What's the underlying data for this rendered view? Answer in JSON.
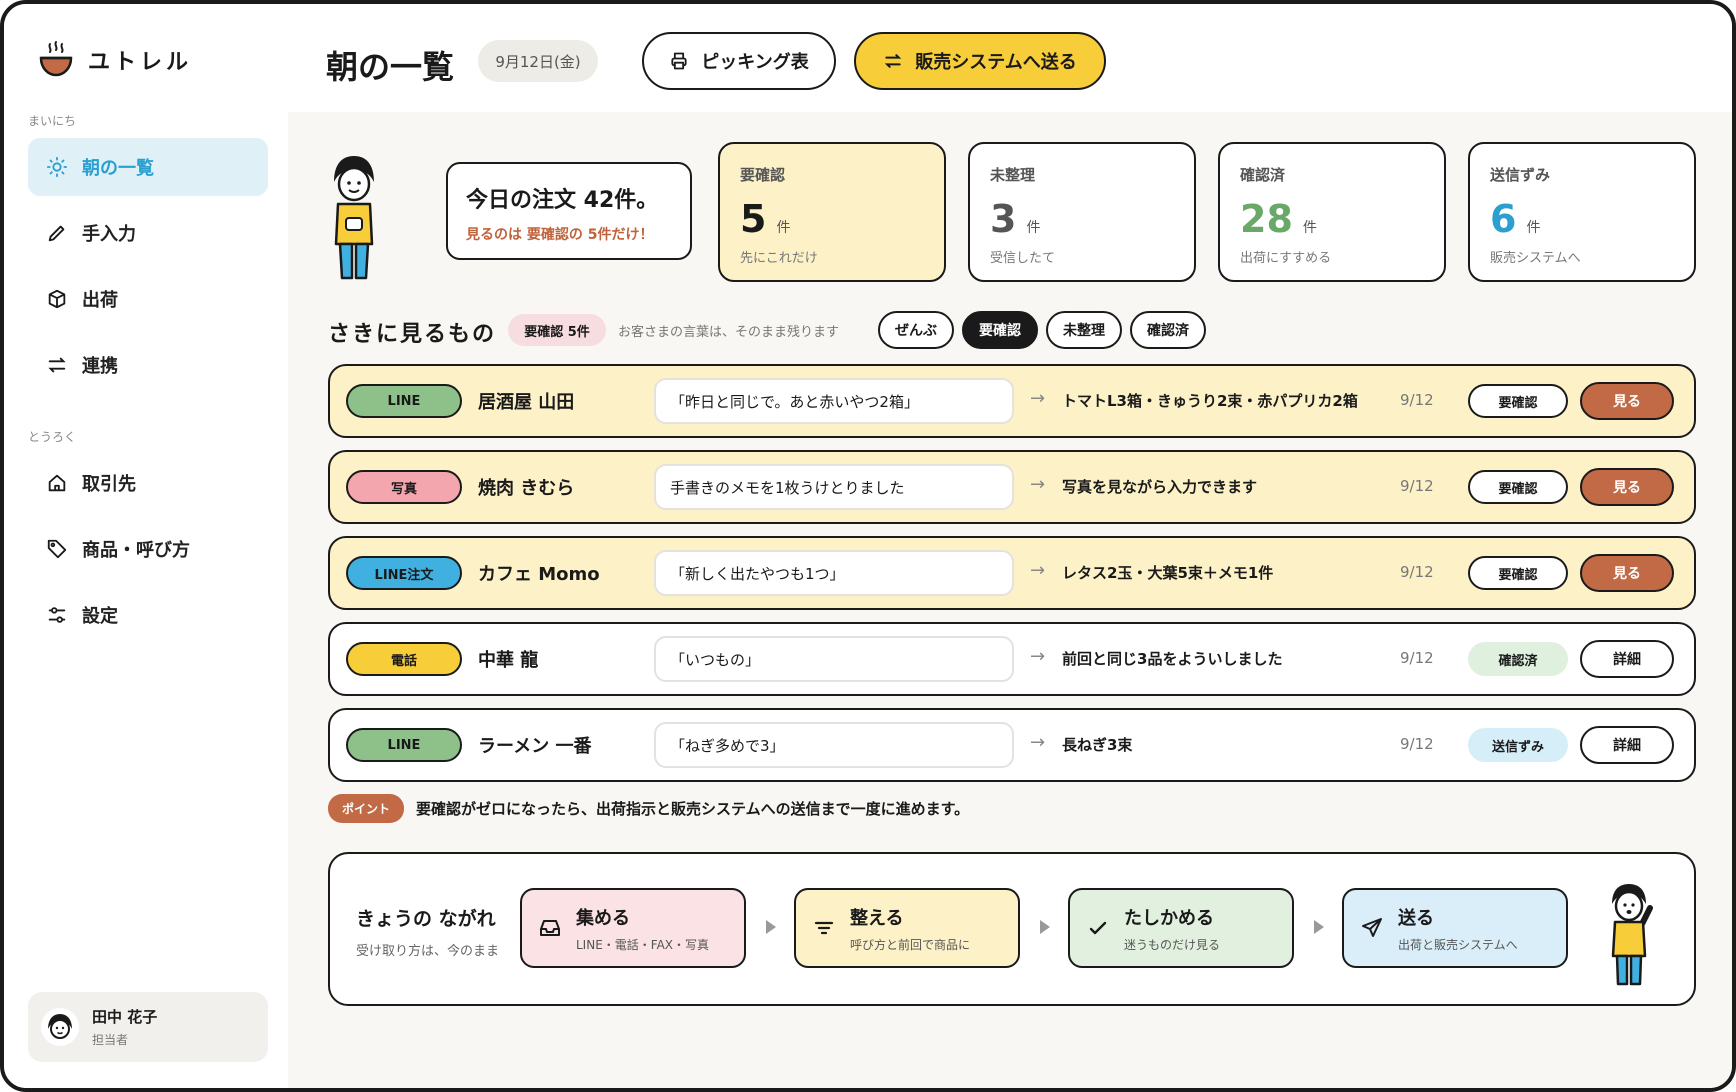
{
  "app": {
    "name": "ユトレル"
  },
  "sidebar": {
    "section_daily": "まいにち",
    "section_register": "とうろく",
    "items": [
      {
        "label": "朝の一覧",
        "icon": "sun-icon"
      },
      {
        "label": "手入力",
        "icon": "pencil-icon"
      },
      {
        "label": "出荷",
        "icon": "box-icon"
      },
      {
        "label": "連携",
        "icon": "swap-icon"
      },
      {
        "label": "取引先",
        "icon": "home-icon"
      },
      {
        "label": "商品・呼び方",
        "icon": "tag-icon"
      },
      {
        "label": "設定",
        "icon": "sliders-icon"
      }
    ],
    "user": {
      "name": "田中 花子",
      "role": "担当者"
    }
  },
  "header": {
    "title": "朝の一覧",
    "date": "9月12日(金)",
    "print_button": "ピッキング表",
    "send_button": "販売システムへ送る"
  },
  "summary": {
    "main": "今日の注文 42件。",
    "sub": "見るのは 要確認の 5件だけ！"
  },
  "stats": [
    {
      "label": "要確認",
      "value": "5",
      "unit": "件",
      "caption": "先にこれだけ",
      "color": "#1a1a1a",
      "bg": "#fdf1c8"
    },
    {
      "label": "未整理",
      "value": "3",
      "unit": "件",
      "caption": "受信したて",
      "color": "#555555",
      "bg": "#ffffff"
    },
    {
      "label": "確認済",
      "value": "28",
      "unit": "件",
      "caption": "出荷にすすめる",
      "color": "#6aa86a",
      "bg": "#ffffff"
    },
    {
      "label": "送信ずみ",
      "value": "6",
      "unit": "件",
      "caption": "販売システムへ",
      "color": "#2a9fd0",
      "bg": "#ffffff"
    }
  ],
  "section": {
    "title": "さきに見るもの",
    "chip": "要確認 5件",
    "note": "お客さまの言葉は、そのまま残ります",
    "filters": [
      "ぜんぶ",
      "要確認",
      "未整理",
      "確認済"
    ]
  },
  "orders": [
    {
      "source": "LINE",
      "source_color": "#8ec08a",
      "customer": "居酒屋 山田",
      "quote": "「昨日と同じで。あと赤いやつ2箱」",
      "result": "トマトL3箱・きゅうり2束・赤パプリカ2箱",
      "date": "9/12",
      "status": "要確認",
      "action": "見る"
    },
    {
      "source": "写真",
      "source_color": "#f4a6ae",
      "customer": "焼肉 きむら",
      "quote": "手書きのメモを1枚うけとりました",
      "result": "写真を見ながら入力できます",
      "date": "9/12",
      "status": "要確認",
      "action": "見る"
    },
    {
      "source": "LINE注文",
      "source_color": "#3fb0e0",
      "customer": "カフェ Momo",
      "quote": "「新しく出たやつも1つ」",
      "result": "レタス2玉・大葉5束＋メモ1件",
      "date": "9/12",
      "status": "要確認",
      "action": "見る"
    },
    {
      "source": "電話",
      "source_color": "#f7cd3a",
      "customer": "中華 龍",
      "quote": "「いつもの」",
      "result": "前回と同じ3品をよういしました",
      "date": "9/12",
      "status": "確認済",
      "action": "詳細"
    },
    {
      "source": "LINE",
      "source_color": "#8ec08a",
      "customer": "ラーメン 一番",
      "quote": "「ねぎ多めで3」",
      "result": "長ねぎ3束",
      "date": "9/12",
      "status": "送信ずみ",
      "action": "詳細"
    }
  ],
  "point": {
    "tag": "ポイント",
    "text": "要確認がゼロになったら、出荷指示と販売システムへの送信まで一度に進めます。"
  },
  "flow": {
    "title": "きょうの ながれ",
    "subtitle": "受け取り方は、今のまま",
    "steps": [
      {
        "title": "集める",
        "sub": "LINE・電話・FAX・写真",
        "icon": "inbox-icon",
        "bg": "#fbe2e4"
      },
      {
        "title": "整える",
        "sub": "呼び方と前回で商品に",
        "icon": "filter-icon",
        "bg": "#fdf1c8"
      },
      {
        "title": "たしかめる",
        "sub": "迷うものだけ見る",
        "icon": "check-icon",
        "bg": "#e2f1df"
      },
      {
        "title": "送る",
        "sub": "出荷と販売システムへ",
        "icon": "send-icon",
        "bg": "#d9eef8"
      }
    ]
  }
}
